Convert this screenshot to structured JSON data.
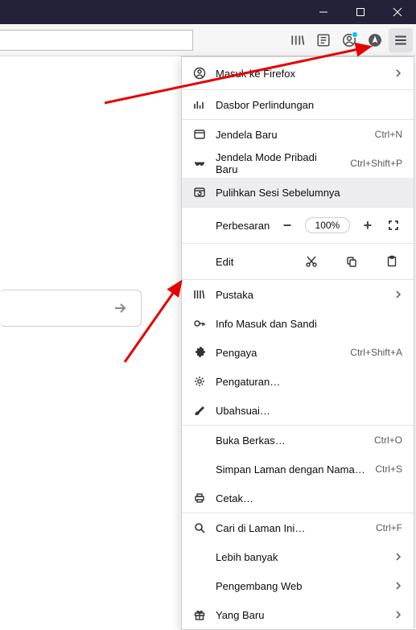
{
  "window_controls": {
    "minimize": "–",
    "maximize": "❐",
    "close": "✕"
  },
  "toolbar": {
    "library_icon": "library",
    "reader_icon": "reader-view",
    "account_icon": "account",
    "browsing_icon": "browsing",
    "menu_icon": "menu"
  },
  "menu": {
    "sign_in": "Masuk ke Firefox",
    "protection": "Dasbor Perlindungan",
    "new_window": "Jendela Baru",
    "new_window_key": "Ctrl+N",
    "private_window": "Jendela Mode Pribadi Baru",
    "private_window_key": "Ctrl+Shift+P",
    "restore": "Pulihkan Sesi Sebelumnya",
    "zoom_label": "Perbesaran",
    "zoom_value": "100%",
    "edit_label": "Edit",
    "library": "Pustaka",
    "logins": "Info Masuk dan Sandi",
    "addons": "Pengaya",
    "addons_key": "Ctrl+Shift+A",
    "settings": "Pengaturan…",
    "customize": "Ubahsuai…",
    "open_file": "Buka Berkas…",
    "open_file_key": "Ctrl+O",
    "save_page": "Simpan Laman dengan Nama…",
    "save_page_key": "Ctrl+S",
    "print": "Cetak…",
    "find": "Cari di Laman Ini…",
    "find_key": "Ctrl+F",
    "more": "Lebih banyak",
    "webdev": "Pengembang Web",
    "whatsnew": "Yang Baru"
  }
}
